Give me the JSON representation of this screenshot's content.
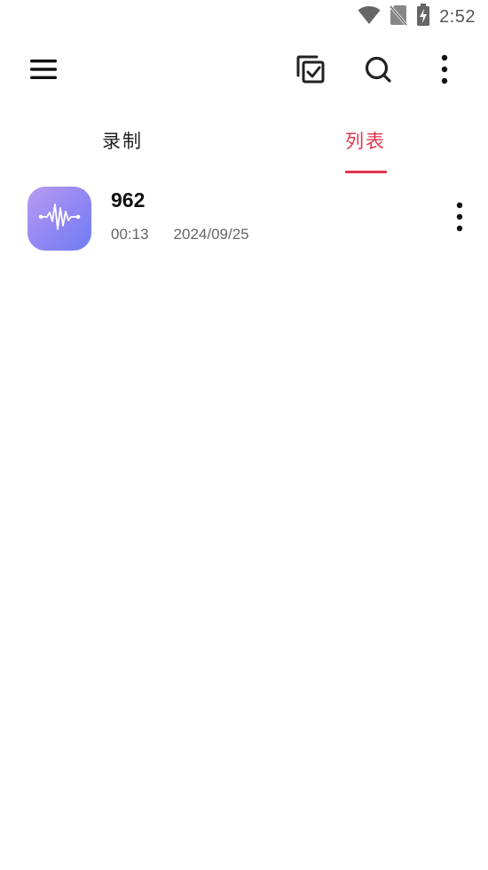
{
  "status_bar": {
    "time": "2:52",
    "icons": [
      "wifi-icon",
      "no-sim-icon",
      "battery-charging-icon"
    ]
  },
  "toolbar": {
    "icons": [
      "menu-icon",
      "multi-select-icon",
      "search-icon",
      "more-vert-icon"
    ]
  },
  "tabs": [
    {
      "label": "录制",
      "selected": false
    },
    {
      "label": "列表",
      "selected": true
    }
  ],
  "colors": {
    "accent": "#e0364e",
    "icon_gradient_start": "#b89cf2",
    "icon_gradient_end": "#6f7ef5"
  },
  "recordings": [
    {
      "title": "962",
      "duration": "00:13",
      "date": "2024/09/25",
      "icon": "waveform-icon"
    }
  ]
}
